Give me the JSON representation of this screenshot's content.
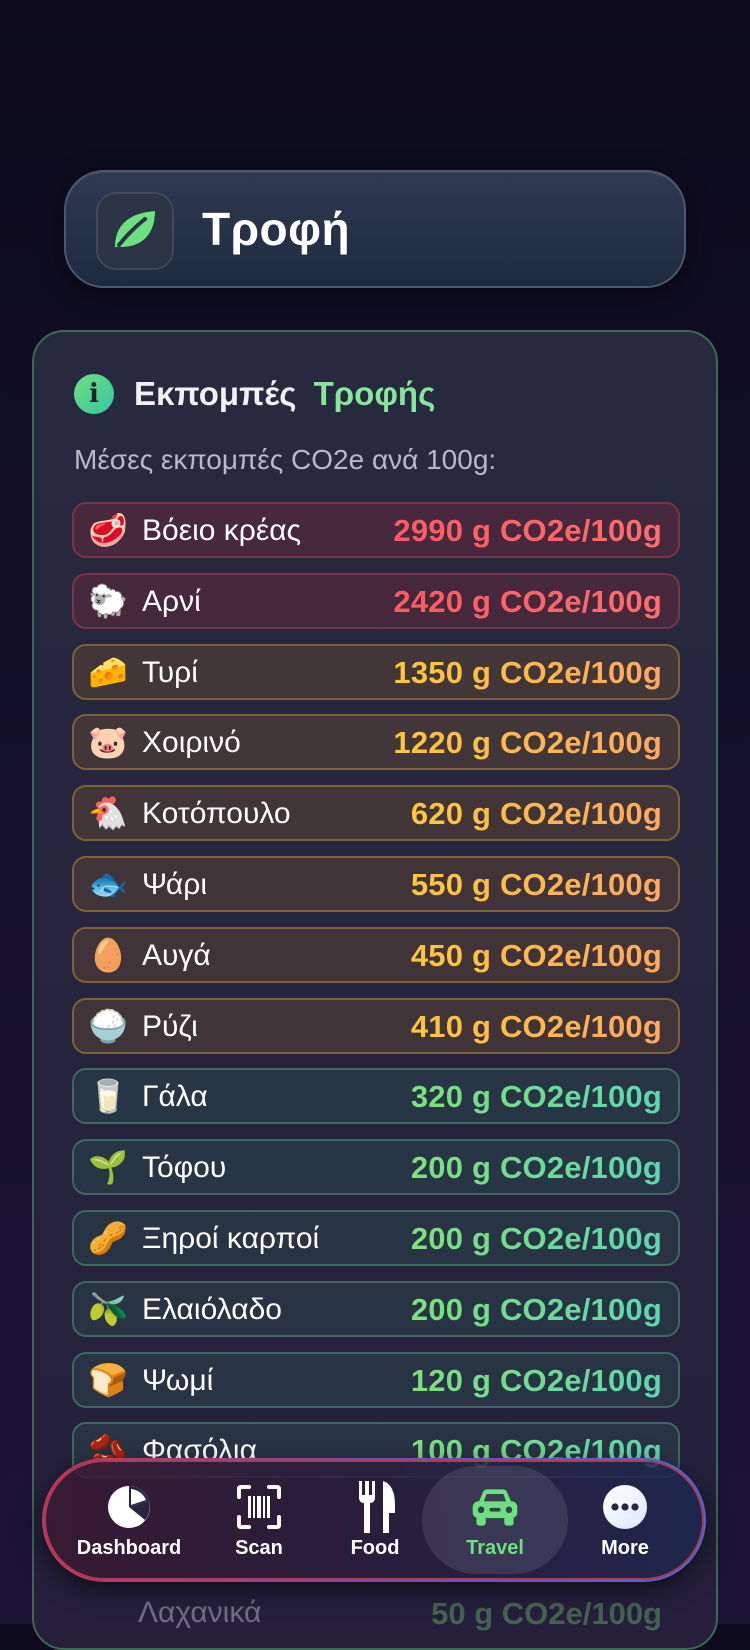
{
  "header": {
    "title": "Τροφή",
    "icon": "leaf-icon"
  },
  "card": {
    "title_part1": "Εκπομπές",
    "title_part2": "Τροφής",
    "subtitle": "Μέσες εκπομπές CO2e ανά 100g:",
    "rows": [
      {
        "emoji": "🥩",
        "label": "Βόειο κρέας",
        "value": "2990 g CO2e/100g",
        "level": "red"
      },
      {
        "emoji": "🐑",
        "label": "Αρνί",
        "value": "2420 g CO2e/100g",
        "level": "red"
      },
      {
        "emoji": "🧀",
        "label": "Τυρί",
        "value": "1350 g CO2e/100g",
        "level": "orange"
      },
      {
        "emoji": "🐷",
        "label": "Χοιρινό",
        "value": "1220 g CO2e/100g",
        "level": "orange"
      },
      {
        "emoji": "🐔",
        "label": "Κοτόπουλο",
        "value": "620 g CO2e/100g",
        "level": "orange"
      },
      {
        "emoji": "🐟",
        "label": "Ψάρι",
        "value": "550 g CO2e/100g",
        "level": "orange"
      },
      {
        "emoji": "🥚",
        "label": "Αυγά",
        "value": "450 g CO2e/100g",
        "level": "orange"
      },
      {
        "emoji": "🍚",
        "label": "Ρύζι",
        "value": "410 g CO2e/100g",
        "level": "orange"
      },
      {
        "emoji": "🥛",
        "label": "Γάλα",
        "value": "320 g CO2e/100g",
        "level": "green"
      },
      {
        "emoji": "🌱",
        "label": "Τόφου",
        "value": "200 g CO2e/100g",
        "level": "green"
      },
      {
        "emoji": "🥜",
        "label": "Ξηροί καρποί",
        "value": "200 g CO2e/100g",
        "level": "green"
      },
      {
        "emoji": "🫒",
        "label": "Ελαιόλαδο",
        "value": "200 g CO2e/100g",
        "level": "green"
      },
      {
        "emoji": "🍞",
        "label": "Ψωμί",
        "value": "120 g CO2e/100g",
        "level": "green"
      },
      {
        "emoji": "🫘",
        "label": "Φασόλια",
        "value": "100 g CO2e/100g",
        "level": "green"
      }
    ],
    "below_row": {
      "label": "Λαχανικά",
      "value": "50 g CO2e/100g"
    }
  },
  "tabbar": {
    "tabs": [
      {
        "label": "Dashboard",
        "icon": "pie-chart-icon"
      },
      {
        "label": "Scan",
        "icon": "barcode-scan-icon"
      },
      {
        "label": "Food",
        "icon": "fork-knife-icon"
      },
      {
        "label": "Travel",
        "icon": "car-icon",
        "active": true
      },
      {
        "label": "More",
        "icon": "ellipsis-circle-icon"
      }
    ]
  },
  "colors": {
    "accent_green": "#6fe07f",
    "red_value": "#ff5a62",
    "orange_value": "#ffc83a",
    "green_value": "#7ee07a"
  }
}
